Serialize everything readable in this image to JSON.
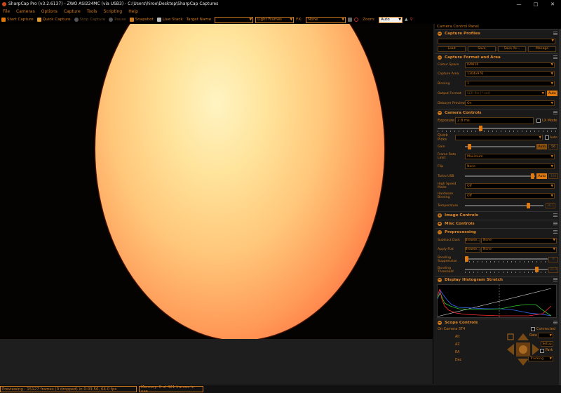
{
  "window": {
    "title": "SharpCap Pro (v3.2.6137) - ZWO ASI224MC (via USB3) - C:\\Users\\hiroo\\Desktop\\SharpCap Captures"
  },
  "menu": [
    "File",
    "Cameras",
    "Options",
    "Capture",
    "Tools",
    "Scripting",
    "Help"
  ],
  "toolbar": {
    "start_capture": "Start Capture",
    "quick_capture": "Quick Capture",
    "stop_capture": "Stop Capture",
    "pause": "Pause",
    "snapshot": "Snapshot",
    "live_stack": "Live Stack",
    "target_name_label": "Target Name",
    "target_name_value": "",
    "frame_type": "Light Frames",
    "fx_label": "FX:",
    "fx_value": "None",
    "zoom_label": "Zoom:",
    "zoom_value": "Auto"
  },
  "status": {
    "previewing": "Previewing : 15127 frames (0 dropped) in 0:03:56, 64.0 fps",
    "memory": "Memory: 0 of 421 frames in use."
  },
  "panel": {
    "title": "Camera Control Panel",
    "capture_profiles": {
      "title": "Capture Profiles",
      "buttons": [
        "Load",
        "Save",
        "Save As...",
        "Manage"
      ]
    },
    "capture_format": {
      "title": "Capture Format and Area",
      "rows": [
        {
          "label": "Colour Space",
          "value": "RAW16"
        },
        {
          "label": "Capture Area",
          "value": "1304x976"
        },
        {
          "label": "Binning",
          "value": "1"
        },
        {
          "label": "Output Format",
          "value": "SER file (*.ser)",
          "auto": "Auto"
        },
        {
          "label": "Debayer Preview",
          "value": "On"
        }
      ]
    },
    "camera_controls": {
      "title": "Camera Controls",
      "exposure_label": "Exposure",
      "exposure_value": "2.8 ms",
      "lx_mode": "LX Mode",
      "quick_picks": "Quick Picks",
      "auto": "Auto",
      "gain_label": "Gain",
      "gain_value": "56",
      "frame_rate_label": "Frame Rate Limit",
      "frame_rate_value": "Maximum",
      "flip_label": "Flip",
      "flip_value": "None",
      "turbo_label": "Turbo USB",
      "turbo_value": "100",
      "high_speed_label": "High Speed Mode",
      "high_speed_value": "Off",
      "hw_binning_label": "Hardware Binning",
      "hw_binning_value": "Off",
      "temperature_label": "Temperature",
      "temperature_value": "36.1"
    },
    "image_controls": {
      "title": "Image Controls"
    },
    "misc_controls": {
      "title": "Misc Controls"
    },
    "preprocessing": {
      "title": "Preprocessing",
      "subtract_dark_label": "Subtract Dark",
      "apply_flat_label": "Apply Flat",
      "browse": "Browse...",
      "none": "None",
      "banding_suppression_label": "Banding Suppression",
      "banding_suppression_value": "0",
      "banding_threshold_label": "Banding Threshold",
      "banding_threshold_value": "35.0"
    },
    "histogram": {
      "title": "Display Histogram Stretch"
    },
    "scope": {
      "title": "Scope Controls",
      "device": "On Camera ST4",
      "connected": "Connected",
      "labels": [
        "Alt",
        "AZ",
        "RA",
        "Dec"
      ],
      "rate_label": "Rate",
      "setup": "Setup",
      "park": "Park",
      "tracking": "Tracking"
    }
  }
}
